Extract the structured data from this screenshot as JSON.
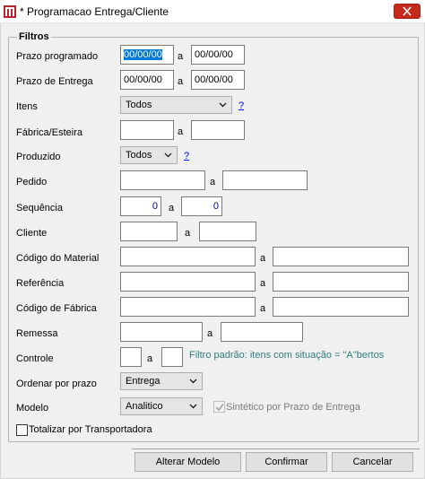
{
  "window": {
    "title": "* Programacao Entrega/Cliente"
  },
  "filters": {
    "legend": "Filtros",
    "a_label": "a",
    "prazo_programado": {
      "label": "Prazo programado",
      "from": "00/00/00",
      "to": "00/00/00"
    },
    "prazo_entrega": {
      "label": "Prazo de Entrega",
      "from": "00/00/00",
      "to": "00/00/00"
    },
    "itens": {
      "label": "Itens",
      "value": "Todos",
      "help": "?"
    },
    "fabrica_esteira": {
      "label": "Fábrica/Esteira",
      "from": "",
      "to": ""
    },
    "produzido": {
      "label": "Produzido",
      "value": "Todos",
      "help": "?"
    },
    "pedido": {
      "label": "Pedido",
      "from": "",
      "to": ""
    },
    "sequencia": {
      "label": "Sequência",
      "from": "0",
      "to": "0"
    },
    "cliente": {
      "label": "Cliente",
      "from": "",
      "to": ""
    },
    "codigo_material": {
      "label": "Código do Material",
      "from": "",
      "to": ""
    },
    "referencia": {
      "label": "Referência",
      "from": "",
      "to": ""
    },
    "codigo_fabrica": {
      "label": "Código de Fábrica",
      "from": "",
      "to": ""
    },
    "remessa": {
      "label": "Remessa",
      "from": "",
      "to": ""
    },
    "controle": {
      "label": "Controle",
      "from": "",
      "to": "",
      "note": "Filtro padrão: itens com situação = \"A\"bertos"
    },
    "ordenar_por_prazo": {
      "label": "Ordenar por prazo",
      "value": "Entrega"
    },
    "modelo": {
      "label": "Modelo",
      "value": "Analitico",
      "sintetico_label": "Sintético por Prazo de Entrega",
      "sintetico_checked": true
    },
    "totalizar": {
      "label": "Totalizar por Transportadora",
      "checked": false
    }
  },
  "buttons": {
    "alterar_modelo": "Alterar Modelo",
    "confirmar": "Confirmar",
    "cancelar": "Cancelar"
  },
  "colors": {
    "accent": "#0078d7",
    "close": "#c42b1c",
    "link": "#0000ff",
    "note": "#2e7d7d"
  }
}
